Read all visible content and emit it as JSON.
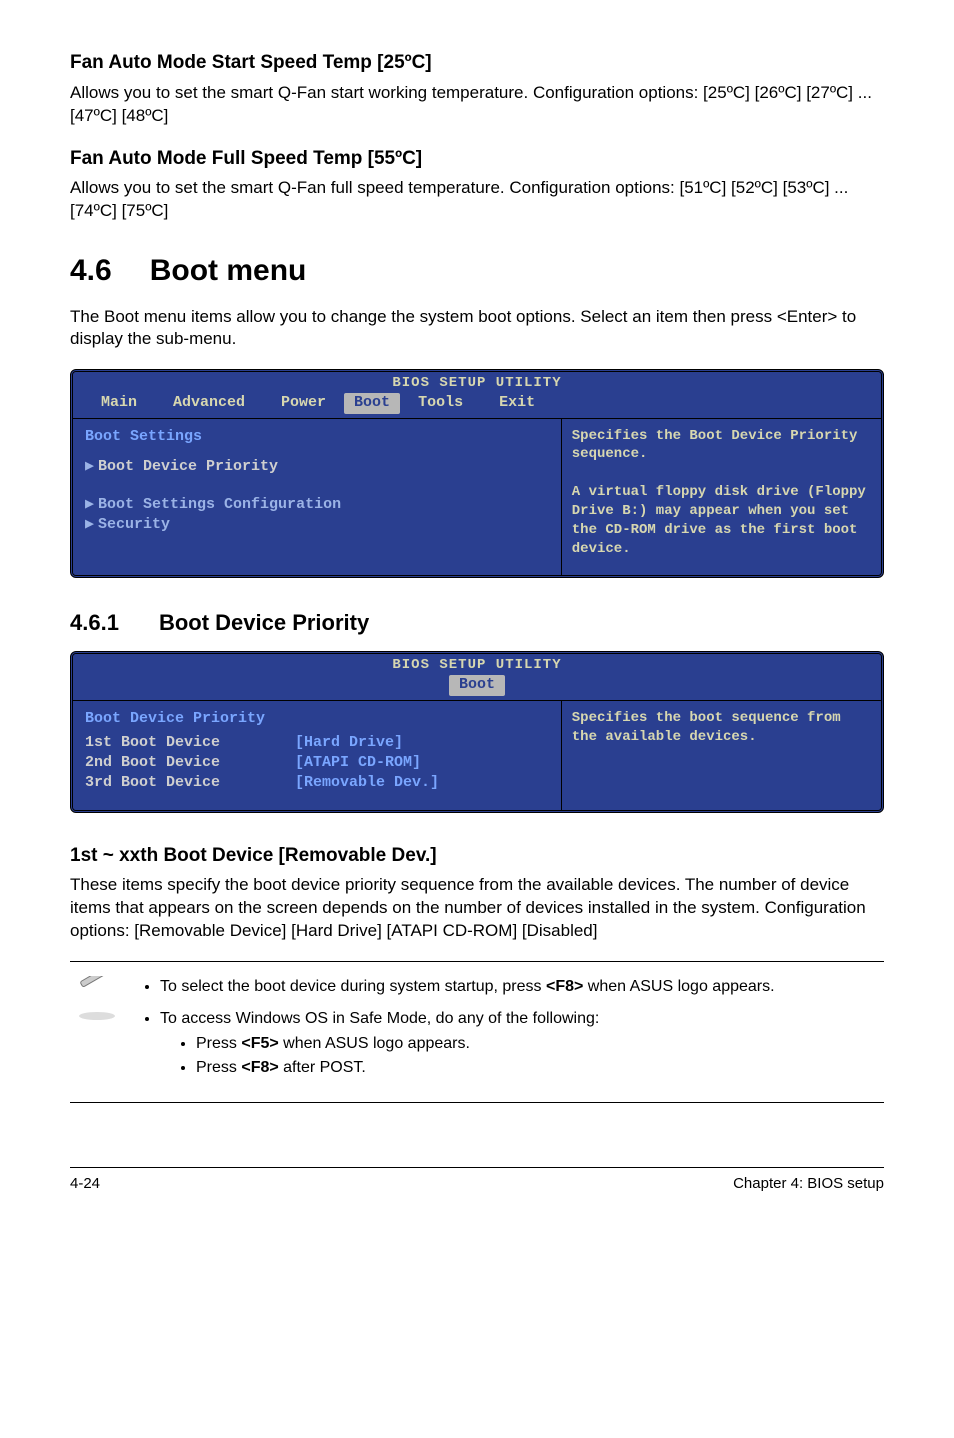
{
  "section1": {
    "heading": "Fan Auto Mode Start Speed Temp [25ºC]",
    "para": "Allows you to set the smart Q-Fan start working temperature. Configuration options: [25ºC] [26ºC] [27ºC] ... [47ºC] [48ºC]"
  },
  "section2": {
    "heading": "Fan Auto Mode Full Speed Temp [55ºC]",
    "para": "Allows you to set the smart Q-Fan full speed temperature. Configuration options: [51ºC] [52ºC] [53ºC] ... [74ºC] [75ºC]"
  },
  "mainHeading": {
    "num": "4.6",
    "text": "Boot menu"
  },
  "mainPara": "The Boot menu items allow you to change the system boot options. Select an item then press <Enter> to display the sub-menu.",
  "bios1": {
    "title": "BIOS SETUP UTILITY",
    "menu": [
      "Main",
      "Advanced",
      "Power",
      "Boot",
      "Tools",
      "Exit"
    ],
    "activeMenu": "Boot",
    "leftHeading": "Boot Settings",
    "items": [
      "Boot Device Priority",
      "Boot Settings Configuration",
      "Security"
    ],
    "help": "Specifies the Boot Device Priority sequence.\n\nA virtual floppy disk drive (Floppy Drive B:) may appear when you set the CD-ROM drive as the first boot device."
  },
  "subHeading": {
    "num": "4.6.1",
    "text": "Boot Device Priority"
  },
  "bios2": {
    "title": "BIOS SETUP UTILITY",
    "activeMenu": "Boot",
    "leftHeading": "Boot Device Priority",
    "rows": [
      {
        "label": "1st Boot Device",
        "value": "[Hard Drive]"
      },
      {
        "label": "2nd Boot Device",
        "value": "[ATAPI CD-ROM]"
      },
      {
        "label": "3rd Boot Device",
        "value": "[Removable Dev.]"
      }
    ],
    "help": "Specifies the boot sequence from the available devices."
  },
  "section3": {
    "heading": "1st ~ xxth Boot Device [Removable Dev.]",
    "para": "These items specify the boot device priority sequence from the available devices. The number of device items that appears on the screen depends on the number of devices installed in the system. Configuration options: [Removable Device] [Hard Drive] [ATAPI CD-ROM] [Disabled]"
  },
  "note": {
    "b1_before": "To select the boot device during system startup, press ",
    "b1_key": "<F8>",
    "b1_after": " when ASUS logo appears.",
    "b2": "To access Windows OS in Safe Mode, do any of the following:",
    "b2a_before": "Press ",
    "b2a_key": "<F5>",
    "b2a_after": " when ASUS logo appears.",
    "b2b_before": "Press ",
    "b2b_key": "<F8>",
    "b2b_after": " after POST."
  },
  "footer": {
    "left": "4-24",
    "right": "Chapter 4: BIOS setup"
  }
}
